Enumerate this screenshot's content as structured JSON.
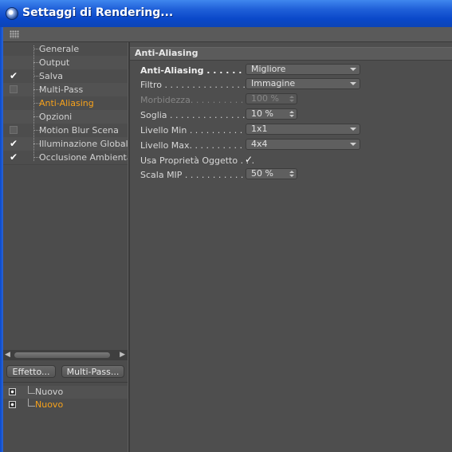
{
  "window": {
    "title": "Settaggi di Rendering..."
  },
  "sidebar": {
    "items": [
      {
        "label": "Generale",
        "check": "none",
        "active": false
      },
      {
        "label": "Output",
        "check": "none",
        "active": false
      },
      {
        "label": "Salva",
        "check": "checked",
        "active": false
      },
      {
        "label": "Multi-Pass",
        "check": "unchecked",
        "active": false
      },
      {
        "label": "Anti-Aliasing",
        "check": "none",
        "active": true
      },
      {
        "label": "Opzioni",
        "check": "none",
        "active": false
      },
      {
        "label": "Motion Blur Scena",
        "check": "unchecked",
        "active": false
      },
      {
        "label": "Illuminazione Globale",
        "check": "checked",
        "active": false
      },
      {
        "label": "Occlusione Ambientale",
        "check": "checked",
        "active": false
      }
    ],
    "buttons": {
      "effect": "Effetto...",
      "multipass": "Multi-Pass..."
    },
    "presets": [
      {
        "label": "Nuovo",
        "active": false
      },
      {
        "label": "Nuovo",
        "active": true
      }
    ]
  },
  "content": {
    "section_title": "Anti-Aliasing",
    "attributes": [
      {
        "label": "Anti-Aliasing . . . . . . . . . .",
        "value": "Migliore",
        "kind": "dropdown",
        "disabled": false,
        "bold": true
      },
      {
        "label": "Filtro . . . . . . . . . . . . . . . . .",
        "value": "Immagine",
        "kind": "dropdown",
        "disabled": false,
        "bold": false
      },
      {
        "label": "Morbidezza. . . . . . . . . . . . .",
        "value": "100 %",
        "kind": "spinner",
        "disabled": true,
        "bold": false
      },
      {
        "label": "Soglia . . . . . . . . . . . . . . . . .",
        "value": "10 %",
        "kind": "spinner",
        "disabled": false,
        "bold": false
      },
      {
        "label": "Livello Min . . . . . . . . . . . . .",
        "value": "1x1",
        "kind": "dropdown",
        "disabled": false,
        "bold": false
      },
      {
        "label": "Livello Max. . . . . . . . . . . . .",
        "value": "4x4",
        "kind": "dropdown",
        "disabled": false,
        "bold": false
      },
      {
        "label": "Usa Proprietà Oggetto . . .",
        "value": "✓",
        "kind": "checkbox",
        "disabled": false,
        "bold": false
      },
      {
        "label": "Scala MIP . . . . . . . . . . . . .",
        "value": "50 %",
        "kind": "spinner",
        "disabled": false,
        "bold": false
      }
    ]
  },
  "icons": {
    "app": "cinema4d-sphere-icon",
    "grip": "grip-icon",
    "check": "checkmark-icon",
    "dropdown": "chevron-down-icon",
    "spinner": "spinner-arrows-icon",
    "preset": "preset-icon"
  },
  "colors": {
    "accent": "#f7a21b",
    "titlebar": "#0a48c9",
    "panel": "#4e4e4e"
  }
}
